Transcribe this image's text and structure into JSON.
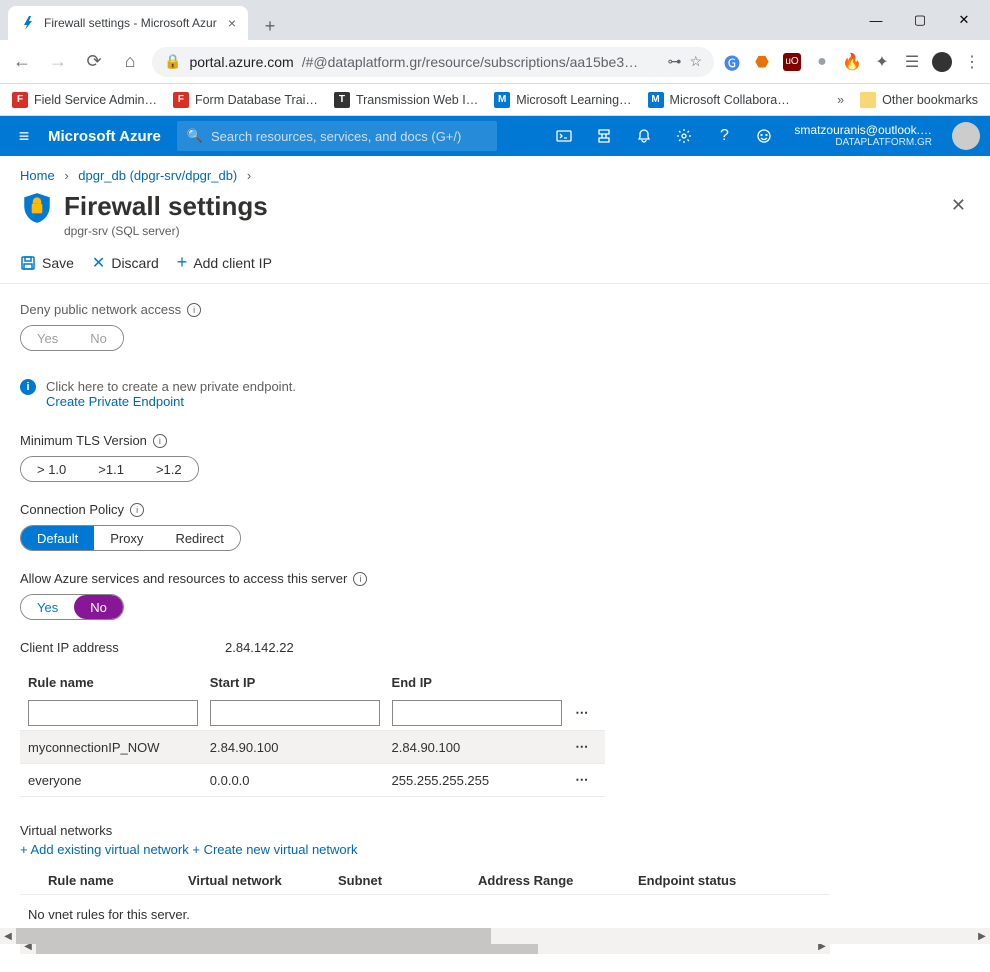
{
  "browser": {
    "tab_title": "Firewall settings - Microsoft Azur",
    "url_host": "portal.azure.com",
    "url_path": "/#@dataplatform.gr/resource/subscriptions/aa15be3…",
    "bookmarks": [
      "Field Service Admin…",
      "Form Database Trai…",
      "Transmission Web I…",
      "Microsoft Learning…",
      "Microsoft Collabora…"
    ],
    "other_bookmarks": "Other bookmarks"
  },
  "azure_header": {
    "brand": "Microsoft Azure",
    "search_placeholder": "Search resources, services, and docs (G+/)",
    "user_email": "smatzouranis@outlook.…",
    "tenant": "DATAPLATFORM.GR"
  },
  "breadcrumb": {
    "home": "Home",
    "item": "dpgr_db (dpgr-srv/dpgr_db)"
  },
  "page": {
    "title": "Firewall settings",
    "subtitle": "dpgr-srv (SQL server)"
  },
  "cmdbar": {
    "save": "Save",
    "discard": "Discard",
    "add_ip": "Add client IP"
  },
  "deny": {
    "label": "Deny public network access",
    "yes": "Yes",
    "no": "No"
  },
  "endpoint_hint": {
    "text": "Click here to create a new private endpoint.",
    "link": "Create Private Endpoint"
  },
  "tls": {
    "label": "Minimum TLS Version",
    "opts": [
      "> 1.0",
      ">1.1",
      ">1.2"
    ]
  },
  "conn": {
    "label": "Connection Policy",
    "opts": [
      "Default",
      "Proxy",
      "Redirect"
    ]
  },
  "allow_azure": {
    "label": "Allow Azure services and resources to access this server",
    "yes": "Yes",
    "no": "No"
  },
  "client_ip": {
    "label": "Client IP address",
    "value": "2.84.142.22"
  },
  "fw": {
    "headers": {
      "name": "Rule name",
      "start": "Start IP",
      "end": "End IP"
    },
    "rows": [
      {
        "name": "myconnectionIP_NOW",
        "start": "2.84.90.100",
        "end": "2.84.90.100"
      },
      {
        "name": "everyone",
        "start": "0.0.0.0",
        "end": "255.255.255.255"
      }
    ]
  },
  "vnet": {
    "label": "Virtual networks",
    "link1": "+ Add existing virtual network",
    "link2": "+ Create new virtual network",
    "headers": [
      "Rule name",
      "Virtual network",
      "Subnet",
      "Address Range",
      "Endpoint status"
    ],
    "empty": "No vnet rules for this server."
  }
}
